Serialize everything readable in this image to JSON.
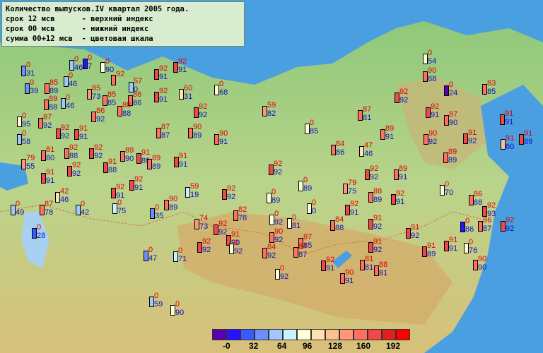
{
  "legend": {
    "line1": "Количество выпусков.IV квартал 2005 года.",
    "line2": "срок 12 мсв      - верхний индекс",
    "line3": "срок 00 мсв      - нижний индекс",
    "line4": "сумма 00+12 мсв  - цветовая шкала"
  },
  "scale": {
    "colors": [
      "#5a00b0",
      "#2a10ff",
      "#3a5aff",
      "#6e8eff",
      "#a0c8ff",
      "#c8f2ff",
      "#ffffd8",
      "#ffe0b0",
      "#ffc090",
      "#ff9878",
      "#ff7060",
      "#f04848",
      "#e02020",
      "#ff0000"
    ],
    "labels": [
      "-0",
      "32",
      "64",
      "96",
      "128",
      "160",
      "192"
    ]
  },
  "stations": [
    {
      "up": "0",
      "lo": "31",
      "c": "#6e8eff"
    },
    {
      "up": "0",
      "lo": "46",
      "c": "#a0c8ff"
    },
    {
      "up": "0",
      "lo": "7",
      "c": "#2a10ff"
    },
    {
      "up": "0",
      "lo": "90",
      "c": "#ffffd8"
    },
    {
      "up": "0",
      "lo": "46",
      "c": "#a0c8ff"
    },
    {
      "up": "0",
      "lo": "39",
      "c": "#6e8eff"
    },
    {
      "up": "85",
      "lo": "89",
      "c": "#ff7060"
    },
    {
      "up": "92",
      "lo": "",
      "c": "#ff7060"
    },
    {
      "up": "92",
      "lo": "91",
      "c": "#f04848"
    },
    {
      "up": "92",
      "lo": "91",
      "c": "#f04848"
    },
    {
      "up": "57",
      "lo": "0",
      "c": "#a0c8ff"
    },
    {
      "up": "0",
      "lo": "54",
      "c": "#ffffd8"
    },
    {
      "up": "85",
      "lo": "73",
      "c": "#ff9878"
    },
    {
      "up": "85",
      "lo": "85",
      "c": "#ff7060"
    },
    {
      "up": "92",
      "lo": "91",
      "c": "#f04848"
    },
    {
      "up": "60",
      "lo": "31",
      "c": "#ffe0b0"
    },
    {
      "up": "0",
      "lo": "68",
      "c": "#ffffd8"
    },
    {
      "up": "90",
      "lo": "88",
      "c": "#ff7060"
    },
    {
      "up": "83",
      "lo": "85",
      "c": "#ff7060"
    },
    {
      "up": "0",
      "lo": "24",
      "c": "#5a00b0"
    },
    {
      "up": "89",
      "lo": "88",
      "c": "#ff7060"
    },
    {
      "up": "0",
      "lo": "46",
      "c": "#a0c8ff"
    },
    {
      "up": "86",
      "lo": "86",
      "c": "#ff7060"
    },
    {
      "up": "92",
      "lo": "92",
      "c": "#f04848"
    },
    {
      "up": "59",
      "lo": "82",
      "c": "#ff9878"
    },
    {
      "up": "87",
      "lo": "81",
      "c": "#ff7060"
    },
    {
      "up": "92",
      "lo": "92",
      "c": "#f04848"
    },
    {
      "up": "92",
      "lo": "91",
      "c": "#f04848"
    },
    {
      "up": "87",
      "lo": "90",
      "c": "#ff7060"
    },
    {
      "up": "91",
      "lo": "91",
      "c": "#f04848"
    },
    {
      "up": "0",
      "lo": "95",
      "c": "#ffffd8"
    },
    {
      "up": "87",
      "lo": "92",
      "c": "#ff7060"
    },
    {
      "up": "86",
      "lo": "92",
      "c": "#ff7060"
    },
    {
      "up": "88",
      "lo": "88",
      "c": "#ff7060"
    },
    {
      "up": "87",
      "lo": "87",
      "c": "#ff7060"
    },
    {
      "up": "90",
      "lo": "89",
      "c": "#ff7060"
    },
    {
      "up": "0",
      "lo": "85",
      "c": "#ffffd8"
    },
    {
      "up": "89",
      "lo": "91",
      "c": "#ff7060"
    },
    {
      "up": "90",
      "lo": "92",
      "c": "#ff7060"
    },
    {
      "up": "91",
      "lo": "92",
      "c": "#f04848"
    },
    {
      "up": "91",
      "lo": "89",
      "c": "#f04848"
    },
    {
      "up": "0",
      "lo": "58",
      "c": "#a0c8ff"
    },
    {
      "up": "92",
      "lo": "92",
      "c": "#f04848"
    },
    {
      "up": "91",
      "lo": "91",
      "c": "#f04848"
    },
    {
      "up": "92",
      "lo": "92",
      "c": "#f04848"
    },
    {
      "up": "89",
      "lo": "90",
      "c": "#ff7060"
    },
    {
      "up": "84",
      "lo": "86",
      "c": "#ff7060"
    },
    {
      "up": "47",
      "lo": "46",
      "c": "#ffe0b0"
    },
    {
      "up": "89",
      "lo": "89",
      "c": "#ff7060"
    },
    {
      "up": "91",
      "lo": "60",
      "c": "#ffc090"
    },
    {
      "up": "81",
      "lo": "80",
      "c": "#ff7060"
    },
    {
      "up": "92",
      "lo": "88",
      "c": "#ff7060"
    },
    {
      "up": "91",
      "lo": "88",
      "c": "#f04848"
    },
    {
      "up": "91",
      "lo": "89",
      "c": "#f04848"
    },
    {
      "up": "91",
      "lo": "91",
      "c": "#f04848"
    },
    {
      "up": "90",
      "lo": "91",
      "c": "#ff7060"
    },
    {
      "up": "79",
      "lo": "55",
      "c": "#ff9878"
    },
    {
      "up": "92",
      "lo": "92",
      "c": "#f04848"
    },
    {
      "up": "91",
      "lo": "91",
      "c": "#f04848"
    },
    {
      "up": "89",
      "lo": "89",
      "c": "#ff7060"
    },
    {
      "up": "92",
      "lo": "92",
      "c": "#f04848"
    },
    {
      "up": "92",
      "lo": "92",
      "c": "#f04848"
    },
    {
      "up": "89",
      "lo": "91",
      "c": "#ff7060"
    },
    {
      "up": "92",
      "lo": "91",
      "c": "#f04848"
    },
    {
      "up": "0",
      "lo": "89",
      "c": "#ffffd8"
    },
    {
      "up": "79",
      "lo": "75",
      "c": "#ff9878"
    },
    {
      "up": "88",
      "lo": "89",
      "c": "#ff7060"
    },
    {
      "up": "92",
      "lo": "91",
      "c": "#f04848"
    },
    {
      "up": "0",
      "lo": "70",
      "c": "#ffffd8"
    },
    {
      "up": "86",
      "lo": "88",
      "c": "#ff7060"
    },
    {
      "up": "92",
      "lo": "93",
      "c": "#f04848"
    },
    {
      "up": "42",
      "lo": "46",
      "c": "#ffe0b0"
    },
    {
      "up": "92",
      "lo": "91",
      "c": "#f04848"
    },
    {
      "up": "59",
      "lo": "19",
      "c": "#c8f2ff"
    },
    {
      "up": "92",
      "lo": "92",
      "c": "#f04848"
    },
    {
      "up": "0",
      "lo": "89",
      "c": "#ffffd8"
    },
    {
      "up": "0",
      "lo": "49",
      "c": "#a0c8ff"
    },
    {
      "up": "87",
      "lo": "78",
      "c": "#ff7060"
    },
    {
      "up": "0",
      "lo": "42",
      "c": "#a0c8ff"
    },
    {
      "up": "0",
      "lo": "75",
      "c": "#c8f2ff"
    },
    {
      "up": "0",
      "lo": "35",
      "c": "#6e8eff"
    },
    {
      "up": "90",
      "lo": "89",
      "c": "#ff7060"
    },
    {
      "up": "82",
      "lo": "78",
      "c": "#ff7060"
    },
    {
      "up": "0",
      "lo": "0",
      "c": "#ffffd8"
    },
    {
      "up": "92",
      "lo": "91",
      "c": "#f04848"
    },
    {
      "up": "91",
      "lo": "92",
      "c": "#f04848"
    },
    {
      "up": "0",
      "lo": "86",
      "c": "#2a10ff"
    },
    {
      "up": "74",
      "lo": "73",
      "c": "#ff9878"
    },
    {
      "up": "92",
      "lo": "92",
      "c": "#f04848"
    },
    {
      "up": "0",
      "lo": "92",
      "c": "#ffffd8"
    },
    {
      "up": "0",
      "lo": "81",
      "c": "#ffffd8"
    },
    {
      "up": "84",
      "lo": "88",
      "c": "#ff7060"
    },
    {
      "up": "91",
      "lo": "92",
      "c": "#f04848"
    },
    {
      "up": "86",
      "lo": "87",
      "c": "#ff7060"
    },
    {
      "up": "92",
      "lo": "92",
      "c": "#f04848"
    },
    {
      "up": "0",
      "lo": "28",
      "c": "#3a5aff"
    },
    {
      "up": "91",
      "lo": "90",
      "c": "#f04848"
    },
    {
      "up": "90",
      "lo": "92",
      "c": "#ff7060"
    },
    {
      "up": "87",
      "lo": "85",
      "c": "#ff7060"
    },
    {
      "up": "91",
      "lo": "92",
      "c": "#f04848"
    },
    {
      "up": "91",
      "lo": "89",
      "c": "#f04848"
    },
    {
      "up": "91",
      "lo": "91",
      "c": "#f04848"
    },
    {
      "up": "0",
      "lo": "76",
      "c": "#ffffd8"
    },
    {
      "up": "0",
      "lo": "47",
      "c": "#6e8eff"
    },
    {
      "up": "0",
      "lo": "71",
      "c": "#c8f2ff"
    },
    {
      "up": "92",
      "lo": "92",
      "c": "#f04848"
    },
    {
      "up": "0",
      "lo": "92",
      "c": "#ffffd8"
    },
    {
      "up": "84",
      "lo": "92",
      "c": "#ff7060"
    },
    {
      "up": "84",
      "lo": "87",
      "c": "#ff7060"
    },
    {
      "up": "92",
      "lo": "91",
      "c": "#f04848"
    },
    {
      "up": "81",
      "lo": "81",
      "c": "#ff7060"
    },
    {
      "up": "88",
      "lo": "81",
      "c": "#ff7060"
    },
    {
      "up": "0",
      "lo": "92",
      "c": "#ffffd8"
    },
    {
      "up": "90",
      "lo": "91",
      "c": "#ff7060"
    },
    {
      "up": "90",
      "lo": "90",
      "c": "#ff7060"
    },
    {
      "up": "0",
      "lo": "59",
      "c": "#a0c8ff"
    },
    {
      "up": "0",
      "lo": "90",
      "c": "#ffffd8"
    }
  ]
}
